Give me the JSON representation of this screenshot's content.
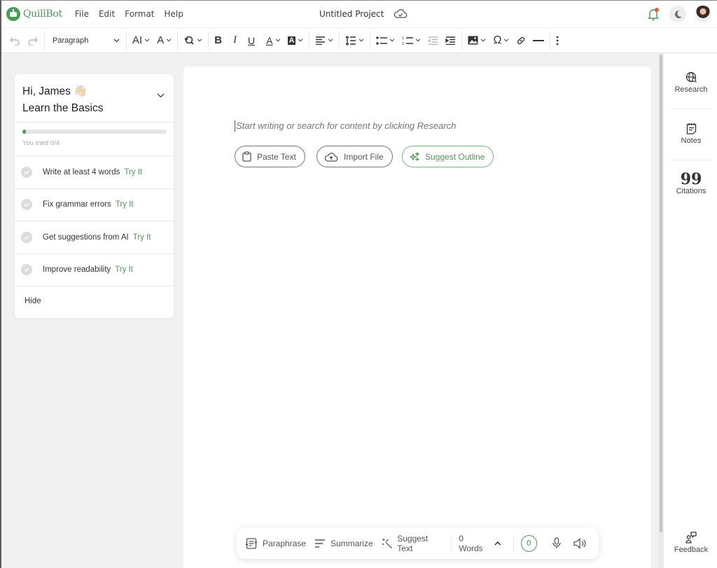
{
  "app": {
    "brand": "QuillBot",
    "menu": [
      "File",
      "Edit",
      "Format",
      "Help"
    ],
    "project_title": "Untitled Project",
    "brand_color": "#4a9b55",
    "notification_dot_color": "#e55a3c"
  },
  "toolbar": {
    "undo_icon": "undo-icon",
    "redo_icon": "redo-icon",
    "block_style": "Paragraph",
    "font_size_label": "AI",
    "text_format_label": "A",
    "bold_label": "B",
    "italic_label": "I",
    "underline_label": "U",
    "font_color_label": "A",
    "highlight_label": "A",
    "omega_label": "Ω"
  },
  "learn": {
    "greeting": "Hi, James 👋🏻",
    "title": "Learn the Basics",
    "progress_fraction": 0,
    "progress_label": "You tried 0/4",
    "tasks": [
      {
        "label": "Write at least 4 words",
        "action": "Try It"
      },
      {
        "label": "Fix grammar errors",
        "action": "Try It"
      },
      {
        "label": "Get suggestions from AI",
        "action": "Try It"
      },
      {
        "label": "Improve readability",
        "action": "Try It"
      }
    ],
    "hide_label": "Hide"
  },
  "editor": {
    "placeholder": "Start writing or search for content by clicking Research",
    "buttons": {
      "paste": "Paste Text",
      "import": "Import File",
      "outline": "Suggest Outline"
    }
  },
  "right_panel": {
    "research": "Research",
    "notes": "Notes",
    "citations": "Citations",
    "feedback": "Feedback"
  },
  "bottom_bar": {
    "paraphrase": "Paraphrase",
    "summarize": "Summarize",
    "suggest_text": "Suggest Text",
    "word_count": "0 Words",
    "issues_count": "0"
  }
}
